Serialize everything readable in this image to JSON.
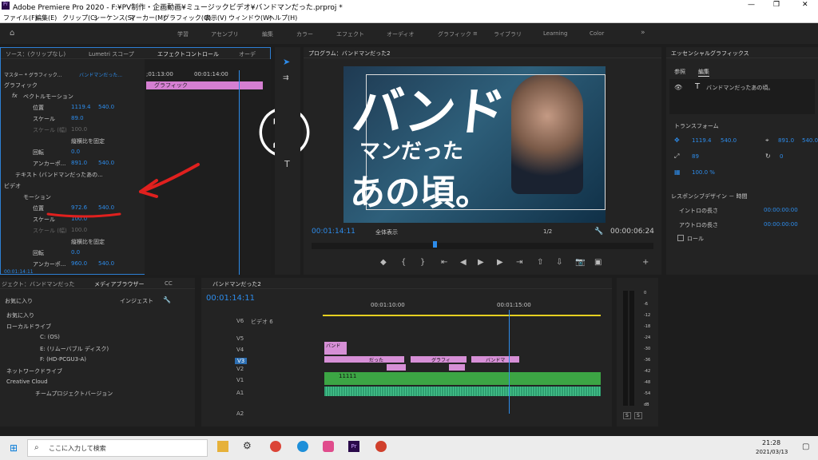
{
  "titlebar": {
    "title": "Adobe Premiere Pro 2020 - F:¥PV制作・企画動画¥ミュージックビデオ¥バンドマンだった.prproj *"
  },
  "menu": [
    "ファイル(F)",
    "編集(E)",
    "クリップ(C)",
    "シーケンス(S)",
    "マーカー(M)",
    "グラフィック(G)",
    "表示(V)",
    "ウィンドウ(W)",
    "ヘルプ(H)"
  ],
  "workspaces": [
    "学習",
    "アセンブリ",
    "編集",
    "カラー",
    "エフェクト",
    "オーディオ",
    "グラフィック",
    "ライブラリ",
    "Learning",
    "Color"
  ],
  "active_workspace": "グラフィック",
  "effects_panel": {
    "tabs": [
      "ソース：(クリップなし)",
      "Lumetri スコープ",
      "エフェクトコントロール",
      "オーデ"
    ],
    "master_label": "マスター * グラフィック...",
    "clip_label": "バンドマンだった...",
    "timecode_start": ";01:13:00",
    "timecode_mid": "00:01:14:00",
    "graphic_clip": "グラフィック",
    "section_graphic": "グラフィック",
    "vector_motion": "ベクトルモーション",
    "position": "位置",
    "position_x": "1119.4",
    "position_y": "540.0",
    "scale": "スケール",
    "scale_val": "89.0",
    "scale_w": "スケール (幅)",
    "scale_w_val": "100.0",
    "uniform_scale": "縦横比を固定",
    "rotation": "回転",
    "rotation_val": "0.0",
    "anchor": "アンカーポ...",
    "anchor_x": "891.0",
    "anchor_y": "540.0",
    "text_layer": "テキスト (バンドマンだったあの...",
    "section_video": "ビデオ",
    "motion": "モーション",
    "m_position": "位置",
    "m_position_x": "972.6",
    "m_position_y": "540.0",
    "m_scale": "スケール",
    "m_scale_val": "100.0",
    "m_scale_w": "スケール (幅)",
    "m_scale_w_val": "100.0",
    "m_uniform": "縦横比を固定",
    "m_rotation": "回転",
    "m_rotation_val": "0.0",
    "m_anchor": "アンカーポ...",
    "m_anchor_x": "960.0",
    "m_anchor_y": "540.0",
    "current_tc": "00:01:14:11"
  },
  "program": {
    "title": "プログラム：バンドマンだった2",
    "overlay_line1": "バンド",
    "overlay_line2": "マンだった",
    "overlay_line3": "あの頃。",
    "annotation": "②",
    "timecode": "00:01:14:11",
    "fit": "全体表示",
    "quality": "1/2",
    "duration": "00:00:06:24"
  },
  "essential": {
    "title": "エッセンシャルグラフィックス",
    "tabs": [
      "参照",
      "編集"
    ],
    "layer": "バンドマンだったあの頃。",
    "transform": "トランスフォーム",
    "pos_x": "1119.4",
    "pos_y": "540.0",
    "anchor_x": "891.0",
    "anchor_y": "540.0",
    "scale": "89",
    "rotation": "0",
    "opacity": "100.0 %",
    "responsive": "レスポンシブデザイン － 時間",
    "intro": "イントロの長さ",
    "intro_val": "00:00:00:00",
    "outro": "アウトロの長さ",
    "outro_val": "00:00:00:00",
    "roll": "ロール"
  },
  "project": {
    "tabs": [
      "ジェクト：バンドマンだった",
      "メディアブラウザー",
      "CC"
    ],
    "favorites_dropdown": "お気に入り",
    "ingest": "インジェスト",
    "items": [
      "お気に入り",
      "ローカルドライブ",
      "C: (OS)",
      "E: (リムーバブル ディスク)",
      "F: (HD-PCGU3-A)",
      "ネットワークドライブ",
      "Creative Cloud",
      "チームプロジェクトバージョン"
    ]
  },
  "timeline": {
    "tab": "バンドマンだった2",
    "timecode": "00:01:14:11",
    "ruler": [
      "00:01:10:00",
      "00:01:15:00"
    ],
    "tracks": [
      "V6",
      "V5",
      "V4",
      "V3",
      "V2",
      "V1",
      "A1",
      "A2"
    ],
    "v6_name": "ビデオ 6",
    "clips": [
      "バンド",
      "だった",
      "グラフィ",
      "バンドマ",
      "11111"
    ]
  },
  "meter": {
    "labels": [
      "0",
      "-6",
      "-12",
      "-18",
      "-24",
      "-30",
      "-36",
      "-42",
      "-48",
      "-54",
      "dB"
    ],
    "solo": [
      "S",
      "S"
    ]
  },
  "taskbar": {
    "search": "ここに入力して検索",
    "time": "21:28",
    "date": "2021/03/13"
  }
}
